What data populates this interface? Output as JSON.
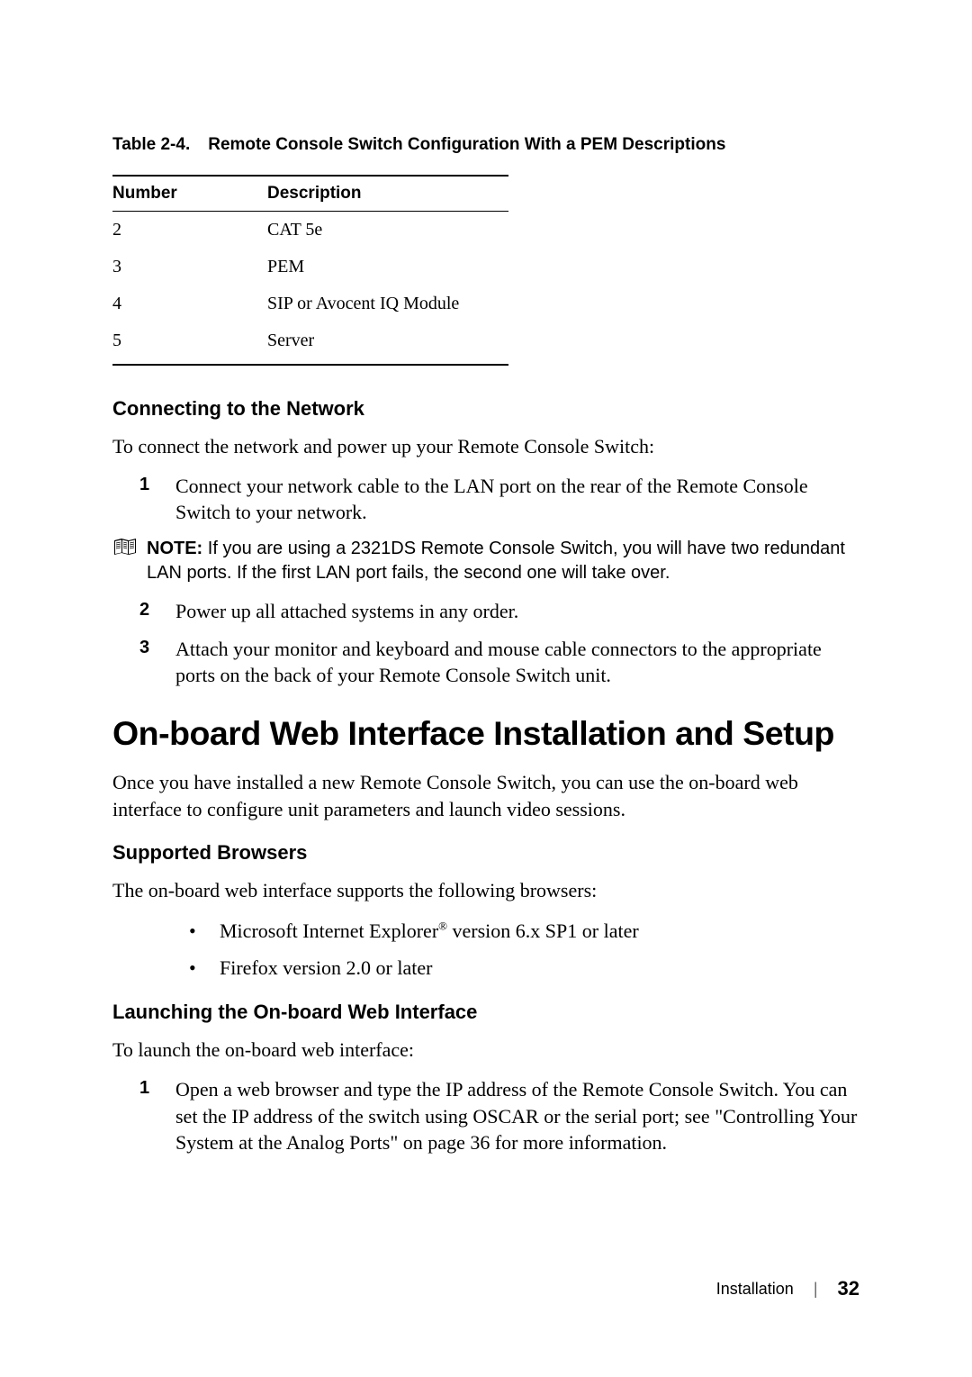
{
  "table": {
    "caption_num": "Table 2-4.",
    "caption_title": "Remote Console Switch Configuration With a PEM Descriptions",
    "header_number": "Number",
    "header_description": "Description",
    "rows": [
      {
        "number": "2",
        "description": "CAT 5e"
      },
      {
        "number": "3",
        "description": "PEM"
      },
      {
        "number": "4",
        "description": "SIP or Avocent IQ Module"
      },
      {
        "number": "5",
        "description": "Server"
      }
    ]
  },
  "section1": {
    "heading": "Connecting to the Network",
    "intro": "To connect the network and power up your Remote Console Switch:",
    "item1_num": "1",
    "item1_text": "Connect your network cable to the LAN port on the rear of the Remote Console Switch to your network.",
    "note_label": "NOTE:",
    "note_text": " If you are using a 2321DS Remote Console Switch, you will have two redundant LAN ports. If the first LAN port fails, the second one will take over.",
    "item2_num": "2",
    "item2_text": "Power up all attached systems in any order.",
    "item3_num": "3",
    "item3_text": "Attach your monitor and keyboard and mouse cable connectors to the appropriate ports on the back of your Remote Console Switch unit."
  },
  "section2": {
    "heading": "On-board Web Interface Installation and Setup",
    "intro": "Once you have installed a new Remote Console Switch, you can use the on-board web interface to configure unit parameters and launch video sessions."
  },
  "section3": {
    "heading": "Supported Browsers",
    "intro": "The on-board web interface supports the following browsers:",
    "bullet1_pre": "Microsoft Internet Explorer",
    "bullet1_sup": "®",
    "bullet1_post": " version 6.x SP1 or later",
    "bullet2": "Firefox version 2.0 or later"
  },
  "section4": {
    "heading": "Launching the On-board Web Interface",
    "intro": "To launch the on-board web interface:",
    "item1_num": "1",
    "item1_text": "Open a web browser and type the IP address of the Remote Console Switch. You can set the IP address of the switch using OSCAR or the serial port; see \"Controlling Your System at the Analog Ports\" on page 36 for more information."
  },
  "footer": {
    "section": "Installation",
    "divider": "|",
    "page": "32"
  }
}
